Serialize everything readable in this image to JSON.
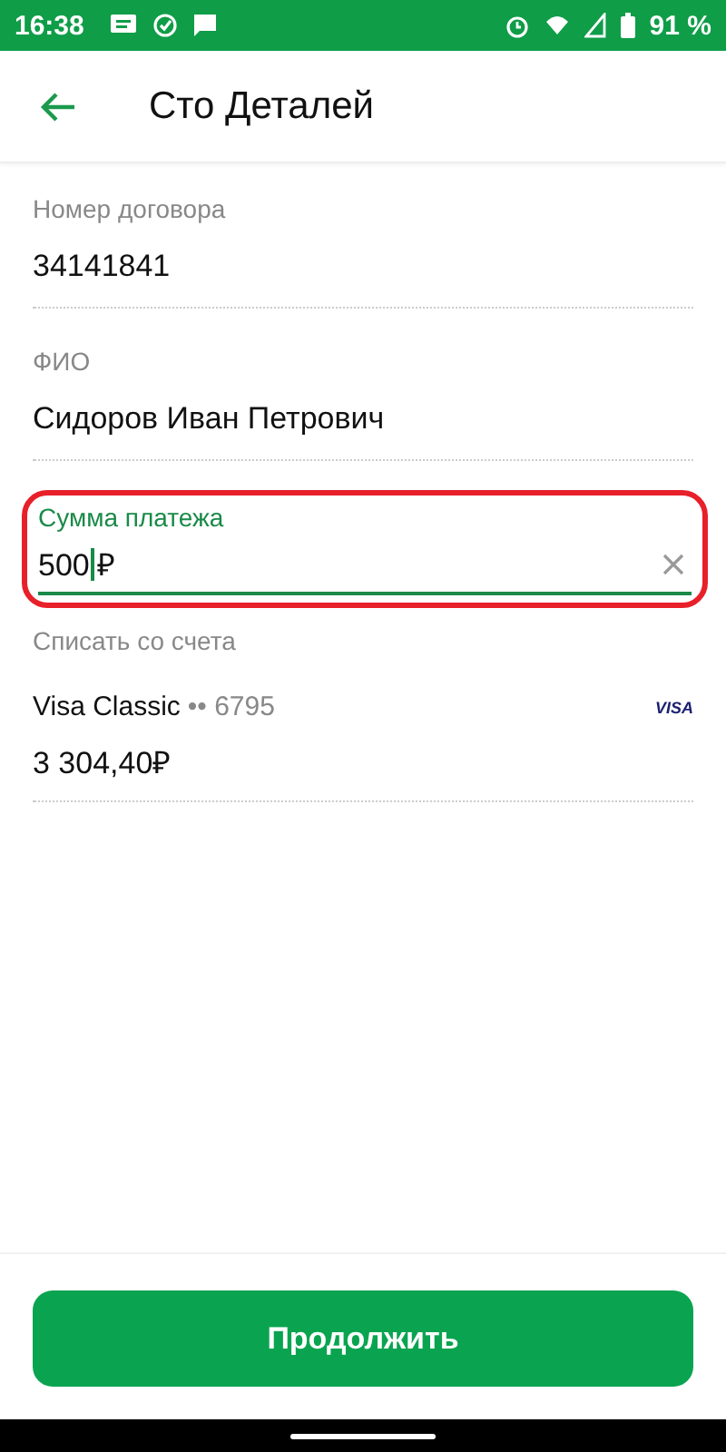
{
  "status_bar": {
    "time": "16:38",
    "battery": "91 %"
  },
  "header": {
    "title": "Сто Деталей"
  },
  "fields": [
    {
      "label": "Номер договора",
      "value": "34141841"
    },
    {
      "label": "ФИО",
      "value": "Сидоров Иван Петрович"
    }
  ],
  "amount_field": {
    "label": "Сумма платежа",
    "value": "500",
    "currency": "₽",
    "highlighted": true
  },
  "account": {
    "label": "Списать со счета",
    "card_name": "Visa Classic",
    "card_mask": "•• 6795",
    "brand": "VISA",
    "balance": "3 304,40₽"
  },
  "button": {
    "label": "Продолжить"
  }
}
